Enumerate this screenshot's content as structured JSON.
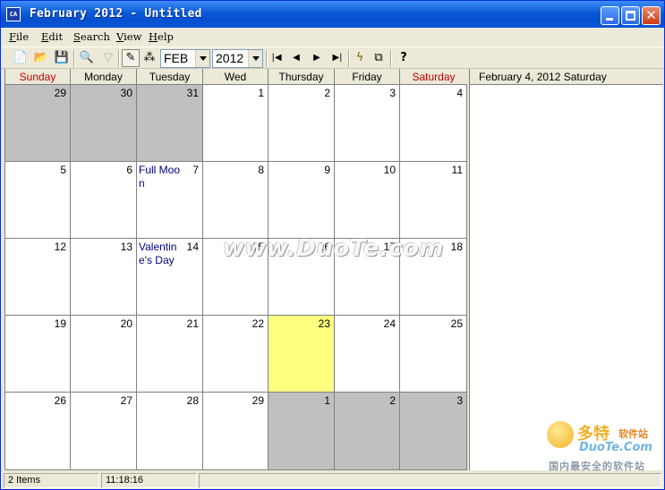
{
  "window": {
    "title": "February 2012 - Untitled",
    "app_icon_text": "CA"
  },
  "menu": [
    "File",
    "Edit",
    "Search",
    "View",
    "Help"
  ],
  "toolbar": {
    "month_value": "FEB",
    "year_value": "2012",
    "icons": [
      "new-icon",
      "open-icon",
      "save-icon",
      "print-preview-icon",
      "filter-icon",
      "edit-note-icon",
      "colors-icon",
      "first-icon",
      "prev-icon",
      "next-icon",
      "last-icon",
      "lightning-icon",
      "copy-icon",
      "help-icon"
    ]
  },
  "calendar": {
    "day_headers": [
      "Sunday",
      "Monday",
      "Tuesday",
      "Wed",
      "Thursday",
      "Friday",
      "Saturday"
    ],
    "weekend_color": "#c00000",
    "other_month_color": "#c0c0c0",
    "today_color": "#ffff80",
    "weeks": [
      [
        {
          "num": "29",
          "other": true
        },
        {
          "num": "30",
          "other": true
        },
        {
          "num": "31",
          "other": true
        },
        {
          "num": "1"
        },
        {
          "num": "2"
        },
        {
          "num": "3"
        },
        {
          "num": "4"
        }
      ],
      [
        {
          "num": "5"
        },
        {
          "num": "6"
        },
        {
          "num": "7",
          "event": "Full Moon"
        },
        {
          "num": "8"
        },
        {
          "num": "9"
        },
        {
          "num": "10"
        },
        {
          "num": "11"
        }
      ],
      [
        {
          "num": "12"
        },
        {
          "num": "13"
        },
        {
          "num": "14",
          "event": "Valentine's Day"
        },
        {
          "num": "15"
        },
        {
          "num": "16"
        },
        {
          "num": "17"
        },
        {
          "num": "18"
        }
      ],
      [
        {
          "num": "19"
        },
        {
          "num": "20"
        },
        {
          "num": "21"
        },
        {
          "num": "22"
        },
        {
          "num": "23",
          "today": true
        },
        {
          "num": "24"
        },
        {
          "num": "25"
        }
      ],
      [
        {
          "num": "26"
        },
        {
          "num": "27"
        },
        {
          "num": "28"
        },
        {
          "num": "29"
        },
        {
          "num": "1",
          "other": true
        },
        {
          "num": "2",
          "other": true
        },
        {
          "num": "3",
          "other": true
        }
      ]
    ]
  },
  "side_panel": {
    "header": "February 4, 2012  Saturday"
  },
  "status": {
    "items": "2 Items",
    "time": "11:18:16"
  },
  "watermark": {
    "text": "www.DuoTe.com",
    "logo_cn": "多特",
    "logo_cn_small": "软件站",
    "logo_en": "DuoTe.Com",
    "logo_sub": "国内最安全的软件站"
  }
}
